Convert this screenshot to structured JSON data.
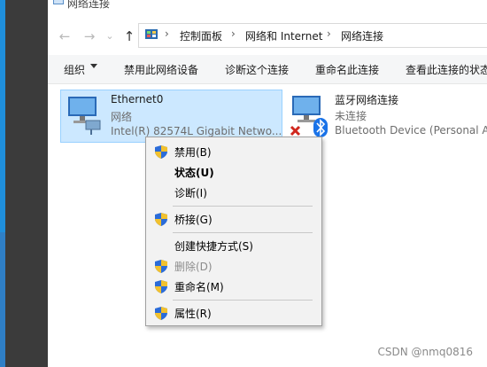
{
  "window": {
    "title": "网络连接"
  },
  "nav": {
    "back": "←",
    "forward": "→",
    "recent": "⌄",
    "up": "↑"
  },
  "breadcrumb": {
    "items": [
      "控制面板",
      "网络和 Internet",
      "网络连接"
    ],
    "separator": "›"
  },
  "toolbar": {
    "organize": "组织",
    "disable": "禁用此网络设备",
    "diagnose": "诊断这个连接",
    "rename": "重命名此连接",
    "view_status": "查看此连接的状态"
  },
  "connections": [
    {
      "name": "Ethernet0",
      "status": "网络",
      "device": "Intel(R) 82574L Gigabit Netwo...",
      "selected": true,
      "icon": "network-adapter-icon"
    },
    {
      "name": "蓝牙网络连接",
      "status": "未连接",
      "device": "Bluetooth Device (Personal A",
      "selected": false,
      "icon": "bluetooth-adapter-icon"
    }
  ],
  "context_menu": {
    "items": [
      {
        "label": "禁用(B)",
        "shield": true
      },
      {
        "label": "状态(U)",
        "bold": true
      },
      {
        "label": "诊断(I)"
      },
      {
        "label": "桥接(G)",
        "shield": true
      },
      {
        "label": "创建快捷方式(S)"
      },
      {
        "label": "删除(D)",
        "shield": true,
        "disabled": true
      },
      {
        "label": "重命名(M)",
        "shield": true
      },
      {
        "label": "属性(R)",
        "shield": true
      }
    ]
  },
  "watermark": "CSDN @nmq0816",
  "colors": {
    "accent": "#1f8fdc",
    "selection": "#cce8ff",
    "menu_bg": "#f2f2f2"
  }
}
